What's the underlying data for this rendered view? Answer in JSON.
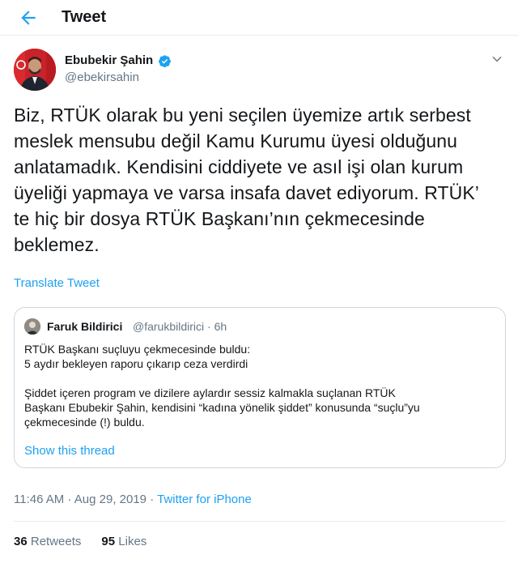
{
  "header": {
    "title": "Tweet",
    "back_icon": "arrow-left-icon"
  },
  "author": {
    "display_name": "Ebubekir Şahin",
    "handle": "@ebekirsahin",
    "verified": true
  },
  "tweet": {
    "text": "Biz, RTÜK olarak bu yeni seçilen üyemize artık serbest\nmeslek mensubu  değil Kamu Kurumu üyesi olduğunu\nanlatamadık. Kendisini ciddiyete ve asıl işi olan kurum\nüyeliği yapmaya ve varsa insafa davet ediyorum. RTÜK’\nte hiç bir dosya RTÜK Başkanı’nın çekmecesinde\nbeklemez.",
    "translate_label": "Translate Tweet",
    "time": "11:46 AM",
    "date": "Aug 29, 2019",
    "source": "Twitter for iPhone"
  },
  "quoted": {
    "display_name": "Faruk Bildirici",
    "handle": "@farukbildirici",
    "time": "6h",
    "text": "RTÜK Başkanı suçluyu çekmecesinde buldu:\n5 aydır bekleyen raporu çıkarıp ceza verdirdi\n\nŞiddet içeren program ve dizilere aylardır sessiz kalmakla suçlanan RTÜK\nBaşkanı Ebubekir Şahin, kendisini “kadına yönelik şiddet” konusunda “suçlu”yu\nçekmecesinde (!) buldu.",
    "show_thread_label": "Show this thread"
  },
  "stats": {
    "retweets_count": "36",
    "retweets_label": "Retweets",
    "likes_count": "95",
    "likes_label": "Likes"
  },
  "colors": {
    "accent": "#1da1f2",
    "text": "#14171a",
    "secondary": "#657786",
    "border": "#ccd6dd"
  }
}
